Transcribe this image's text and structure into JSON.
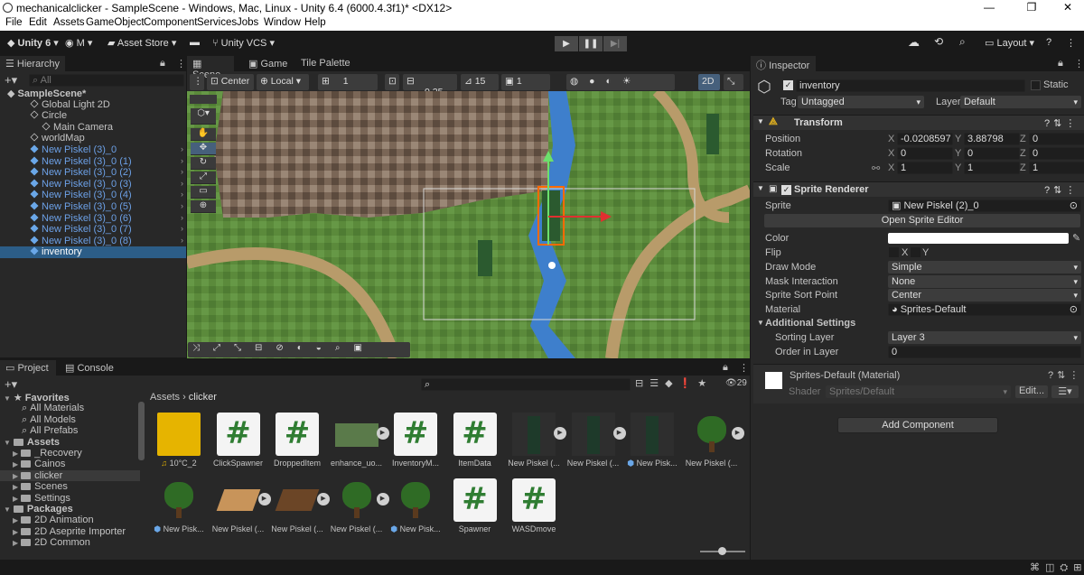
{
  "window": {
    "title": "mechanicalclicker - SampleScene - Windows, Mac, Linux - Unity 6.4 (6000.4.3f1)* <DX12>",
    "controls": [
      "—",
      "❐",
      "✕"
    ]
  },
  "menu": [
    "File",
    "Edit",
    "Assets",
    "GameObject",
    "Component",
    "Services",
    "Jobs",
    "Window",
    "Help"
  ],
  "toolbar": {
    "unity": "Unity 6",
    "account": "M",
    "asset_store": "Asset Store",
    "vcs": "Unity VCS",
    "layout": "Layout"
  },
  "hierarchy": {
    "tab": "Hierarchy",
    "search_placeholder": "All",
    "items": [
      {
        "label": "SampleScene*",
        "indent": 0,
        "blue": false,
        "bold": true
      },
      {
        "label": "Global Light 2D",
        "indent": 2,
        "blue": false
      },
      {
        "label": "Circle",
        "indent": 2,
        "blue": false
      },
      {
        "label": "Main Camera",
        "indent": 3,
        "blue": false
      },
      {
        "label": "worldMap",
        "indent": 2,
        "blue": false
      },
      {
        "label": "New Piskel (3)_0",
        "indent": 2,
        "blue": true
      },
      {
        "label": "New Piskel (3)_0 (1)",
        "indent": 2,
        "blue": true
      },
      {
        "label": "New Piskel (3)_0 (2)",
        "indent": 2,
        "blue": true
      },
      {
        "label": "New Piskel (3)_0 (3)",
        "indent": 2,
        "blue": true
      },
      {
        "label": "New Piskel (3)_0 (4)",
        "indent": 2,
        "blue": true
      },
      {
        "label": "New Piskel (3)_0 (5)",
        "indent": 2,
        "blue": true
      },
      {
        "label": "New Piskel (3)_0 (6)",
        "indent": 2,
        "blue": true
      },
      {
        "label": "New Piskel (3)_0 (7)",
        "indent": 2,
        "blue": true
      },
      {
        "label": "New Piskel (3)_0 (8)",
        "indent": 2,
        "blue": true
      },
      {
        "label": "inventory",
        "indent": 2,
        "blue": true,
        "selected": true
      }
    ]
  },
  "scene_tabs": [
    "Scene",
    "Game",
    "Tile Palette"
  ],
  "scene_toolbar": {
    "pivot": "Center",
    "space": "Local",
    "grid_count": "1",
    "snap_value": "0.25",
    "angle": "15",
    "scale_snap": "1",
    "mode_2d": "2D"
  },
  "inspector": {
    "tab": "Inspector",
    "name": "inventory",
    "static": "Static",
    "tag_label": "Tag",
    "tag": "Untagged",
    "layer_label": "Layer",
    "layer": "Default",
    "transform": {
      "title": "Transform",
      "position": {
        "label": "Position",
        "x": "-0.0208597",
        "y": "3.88798",
        "z": "0"
      },
      "rotation": {
        "label": "Rotation",
        "x": "0",
        "y": "0",
        "z": "0"
      },
      "scale": {
        "label": "Scale",
        "x": "1",
        "y": "1",
        "z": "1"
      }
    },
    "sprite_renderer": {
      "title": "Sprite Renderer",
      "sprite_label": "Sprite",
      "sprite": "New Piskel (2)_0",
      "open_editor": "Open Sprite Editor",
      "color_label": "Color",
      "flip_label": "Flip",
      "flip_x": "X",
      "flip_y": "Y",
      "draw_mode_label": "Draw Mode",
      "draw_mode": "Simple",
      "mask_label": "Mask Interaction",
      "mask": "None",
      "sort_point_label": "Sprite Sort Point",
      "sort_point": "Center",
      "material_label": "Material",
      "material": "Sprites-Default",
      "additional": "Additional Settings",
      "sorting_layer_label": "Sorting Layer",
      "sorting_layer": "Layer 3",
      "order_label": "Order in Layer",
      "order": "0"
    },
    "material_block": {
      "title": "Sprites-Default (Material)",
      "shader_label": "Shader",
      "shader": "Sprites/Default",
      "edit": "Edit..."
    },
    "add_component": "Add Component"
  },
  "project": {
    "tabs": [
      "Project",
      "Console"
    ],
    "breadcrumb": [
      "Assets",
      "clicker"
    ],
    "count": "29",
    "tree": [
      {
        "label": "Favorites",
        "indent": 0,
        "star": true,
        "bold": true
      },
      {
        "label": "All Materials",
        "indent": 2
      },
      {
        "label": "All Models",
        "indent": 2
      },
      {
        "label": "All Prefabs",
        "indent": 2
      },
      {
        "label": "Assets",
        "indent": 0,
        "bold": true,
        "folder": true
      },
      {
        "label": "_Recovery",
        "indent": 1,
        "folder": true
      },
      {
        "label": "Cainos",
        "indent": 1,
        "folder": true
      },
      {
        "label": "clicker",
        "indent": 1,
        "folder": true,
        "selected": true
      },
      {
        "label": "Scenes",
        "indent": 1,
        "folder": true
      },
      {
        "label": "Settings",
        "indent": 1,
        "folder": true
      },
      {
        "label": "Packages",
        "indent": 0,
        "bold": true,
        "folder": true
      },
      {
        "label": "2D Animation",
        "indent": 1,
        "folder": true
      },
      {
        "label": "2D Aseprite Importer",
        "indent": 1,
        "folder": true
      },
      {
        "label": "2D Common",
        "indent": 1,
        "folder": true
      }
    ],
    "assets": [
      {
        "label": "10°C_2",
        "kind": "audio"
      },
      {
        "label": "ClickSpawner",
        "kind": "script"
      },
      {
        "label": "DroppedItem",
        "kind": "script"
      },
      {
        "label": "enhance_uo...",
        "kind": "map",
        "play": true
      },
      {
        "label": "InventoryM...",
        "kind": "script"
      },
      {
        "label": "ItemData",
        "kind": "script"
      },
      {
        "label": "New Piskel (...",
        "kind": "sprite",
        "play": true
      },
      {
        "label": "New Piskel (...",
        "kind": "sprite",
        "play": true
      },
      {
        "label": "New Pisk...",
        "kind": "sprite",
        "prefab": true
      },
      {
        "label": "New Piskel (...",
        "kind": "tree",
        "play": true
      },
      {
        "label": "New Pisk...",
        "kind": "tree",
        "prefab": true
      },
      {
        "label": "New Piskel (...",
        "kind": "plank",
        "play": true
      },
      {
        "label": "New Piskel (...",
        "kind": "plankdark",
        "play": true
      },
      {
        "label": "New Piskel (...",
        "kind": "tree",
        "play": true
      },
      {
        "label": "New Pisk...",
        "kind": "tree",
        "prefab": true
      },
      {
        "label": "Spawner",
        "kind": "script"
      },
      {
        "label": "WASDmove",
        "kind": "script"
      }
    ]
  }
}
